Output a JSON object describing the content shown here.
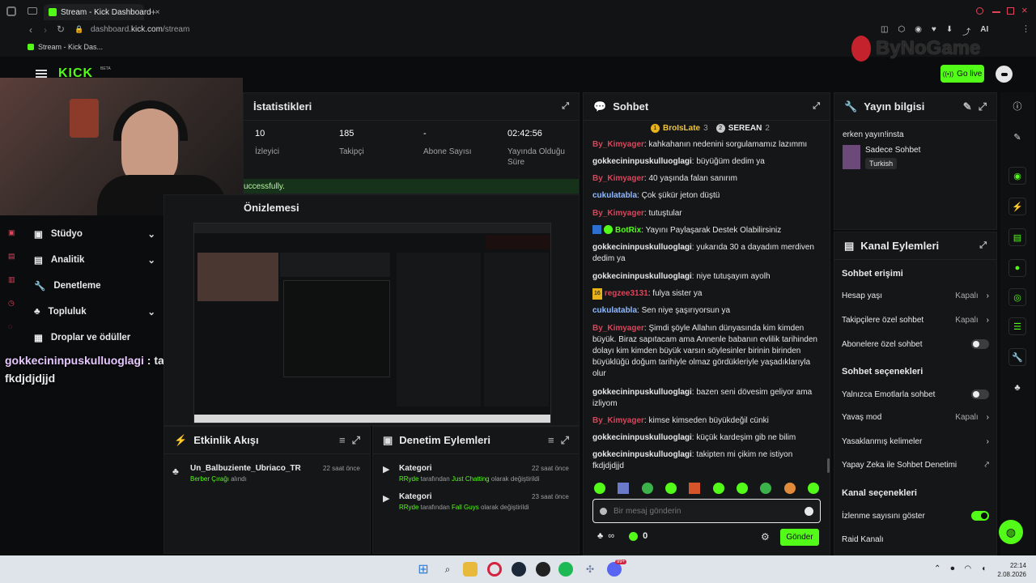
{
  "browser": {
    "tab_title": "Stream - Kick Dashboard",
    "url_prefix": "dashboard.",
    "url_domain": "kick.com",
    "url_path": "/stream",
    "bookmark": "Stream - Kick Das...",
    "ai_label": "AI"
  },
  "header": {
    "logo": "KICK",
    "beta": "BETA",
    "go_live": "Go live",
    "watermark": "ByNoGame"
  },
  "stats": {
    "title": "İstatistikleri",
    "items": [
      {
        "value": "10",
        "label": "İzleyici"
      },
      {
        "value": "185",
        "label": "Takipçi"
      },
      {
        "value": "-",
        "label": "Abone Sayısı"
      },
      {
        "value": "02:42:56",
        "label": "Yayında Olduğu Süre"
      }
    ],
    "notice": "uccessfully."
  },
  "preview": {
    "title": "Önizlemesi"
  },
  "nav": {
    "items": [
      {
        "label": "Stüdyo",
        "chev": "⌄"
      },
      {
        "label": "Analitik",
        "chev": "⌄"
      },
      {
        "label": "Denetleme",
        "chev": ""
      },
      {
        "label": "Topluluk",
        "chev": "⌄"
      },
      {
        "label": "Droplar ve ödüller",
        "chev": ""
      }
    ]
  },
  "overlay_chat": {
    "user": "gokkecininpuskulluoglagi",
    "sep": " : ",
    "text": "takipten mi çikim ne istiyon fkdjdjdjjd"
  },
  "activity": {
    "title": "Etkinlik Akışı",
    "items": [
      {
        "user": "Un_Balbuziente_Ubriaco_TR",
        "time": "22 saat önce",
        "detail": "Berber Çırağı",
        "suffix": " alındı"
      }
    ]
  },
  "moderation": {
    "title": "Denetim Eylemleri",
    "items": [
      {
        "label": "Kategori",
        "time": "22 saat önce",
        "actor": "RRyde",
        "mid": " tarafından ",
        "value": "Just Chatting",
        "suffix": " olarak değiştirildi"
      },
      {
        "label": "Kategori",
        "time": "23 saat önce",
        "actor": "RRyde",
        "mid": " tarafından ",
        "value": "Fall Guys",
        "suffix": " olarak değiştirildi"
      }
    ]
  },
  "chat": {
    "title": "Sohbet",
    "top_users": [
      {
        "name": "BroIsLate",
        "count": "3",
        "rank": "1"
      },
      {
        "name": "SEREAN",
        "count": "2",
        "rank": "2"
      }
    ],
    "messages": [
      {
        "user": "By_Kimyager",
        "color": "red",
        "text": "kahkahanın nedenini sorgulamamız lazımmı"
      },
      {
        "user": "gokkecininpuskulluoglagi",
        "color": "white",
        "text": "büyüğüm dedim ya"
      },
      {
        "user": "By_Kimyager",
        "color": "red",
        "text": "40 yaşında falan sanırım"
      },
      {
        "user": "cukulatabla",
        "color": "blue",
        "text": "Çok şükür jeton düştü"
      },
      {
        "user": "By_Kimyager",
        "color": "red",
        "text": "tutuştular"
      },
      {
        "user": "BotRix",
        "color": "green",
        "text": "Yayını Paylaşarak Destek Olabilirsiniz"
      },
      {
        "user": "gokkecininpuskulluoglagi",
        "color": "white",
        "text": "yukarıda 30 a dayadım merdiven dedim ya"
      },
      {
        "user": "gokkecininpuskulluoglagi",
        "color": "white",
        "text": "niye tutuşayım ayolh"
      },
      {
        "user": "regzee3131",
        "color": "red",
        "text": "fulya sister ya"
      },
      {
        "user": "cukulatabla",
        "color": "blue",
        "text": "Sen niye şaşırıyorsun ya"
      },
      {
        "user": "By_Kimyager",
        "color": "red",
        "text": "Şimdi şöyle Allahın dünyasında kim kimden büyük. Biraz sapıtacam ama Annenle babanın evlilik tarihinden dolayı kim kimden büyük varsın söylesinler birinin birinden büyüklüğü doğum tarihiyle olmaz gördükleriyle yaşadıklarıyla olur"
      },
      {
        "user": "gokkecininpuskulluoglagi",
        "color": "white",
        "text": "bazen seni dövesim geliyor ama izliyom"
      },
      {
        "user": "By_Kimyager",
        "color": "red",
        "text": "kimse kimseden büyükdeğil cünki"
      },
      {
        "user": "gokkecininpuskulluoglagi",
        "color": "white",
        "text": "küçük kardeşim gib ne bilim"
      },
      {
        "user": "gokkecininpuskulluoglagi",
        "color": "white",
        "text": "takipten mi çikim ne istiyon fkdjdjdjjd"
      }
    ],
    "sep": ": ",
    "badge_16": "16",
    "input_placeholder": "Bir mesaj gönderin",
    "infinity": "∞",
    "points": "0",
    "send": "Gönder"
  },
  "stream_info": {
    "title": "Yayın bilgisi",
    "stream_title": "erken yayın!insta",
    "category": "Sadece Sohbet",
    "tag": "Turkish"
  },
  "channel_actions": {
    "title": "Kanal Eylemleri",
    "sec_chat_access": "Sohbet erişimi",
    "account_age": "Hesap yaşı",
    "followers_only": "Takipçilere özel sohbet",
    "closed": "Kapalı",
    "subs_only": "Abonelere özel sohbet",
    "sec_chat_options": "Sohbet seçenekleri",
    "emotes_only": "Yalnızca Emotlarla sohbet",
    "slow_mode": "Yavaş mod",
    "banned_words": "Yasaklanmış kelimeler",
    "ai_moderation": "Yapay Zeka ile Sohbet Denetimi",
    "sec_channel_options": "Kanal seçenekleri",
    "show_viewers": "İzlenme sayısını göster",
    "raid": "Raid Kanalı"
  },
  "taskbar": {
    "time": "22:14",
    "date": "2.08.2026",
    "badge": "99+"
  },
  "colors": {
    "accent": "#53fc18",
    "bg": "#0b0c0d",
    "panel": "#151617",
    "red_user": "#e0435a",
    "blue_user": "#8fb9ff"
  }
}
